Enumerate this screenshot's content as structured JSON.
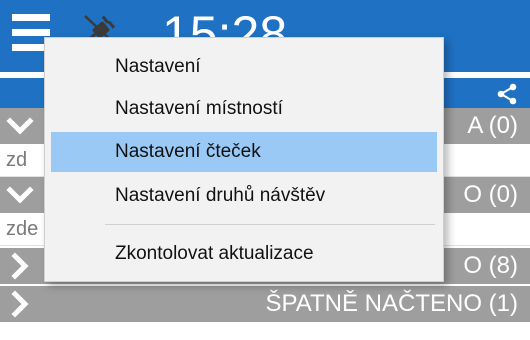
{
  "topbar": {
    "time": "15:28",
    "background_color": "#1f71c3",
    "menu_icon": "hamburger-menu-icon",
    "status_icon": "plug-disconnected-icon",
    "share_icon": "share-icon"
  },
  "groups": [
    {
      "label": "ZPRACOVÁVÁ SE TATA (0)",
      "visible_label": "A (0)",
      "expanded": true,
      "sub_text": "zd"
    },
    {
      "label": "O (0)",
      "visible_label": "O (0)",
      "expanded": true,
      "sub_text": "zde"
    },
    {
      "label": "O (8)",
      "visible_label": "O (8)",
      "expanded": false
    },
    {
      "label": "ŠPATNĚ NAČTENO (1)",
      "visible_label": "ŠPATNĚ NAČTENO (1)",
      "expanded": false
    }
  ],
  "menu": {
    "items": [
      {
        "label": "Nastavení"
      },
      {
        "label": "Nastavení místností"
      },
      {
        "label": "Nastavení čteček",
        "highlighted": true
      },
      {
        "label": "Nastavení druhů návštěv"
      },
      {
        "label": "Zkontolovat aktualizace"
      }
    ],
    "highlight_color": "#99c9f4"
  }
}
